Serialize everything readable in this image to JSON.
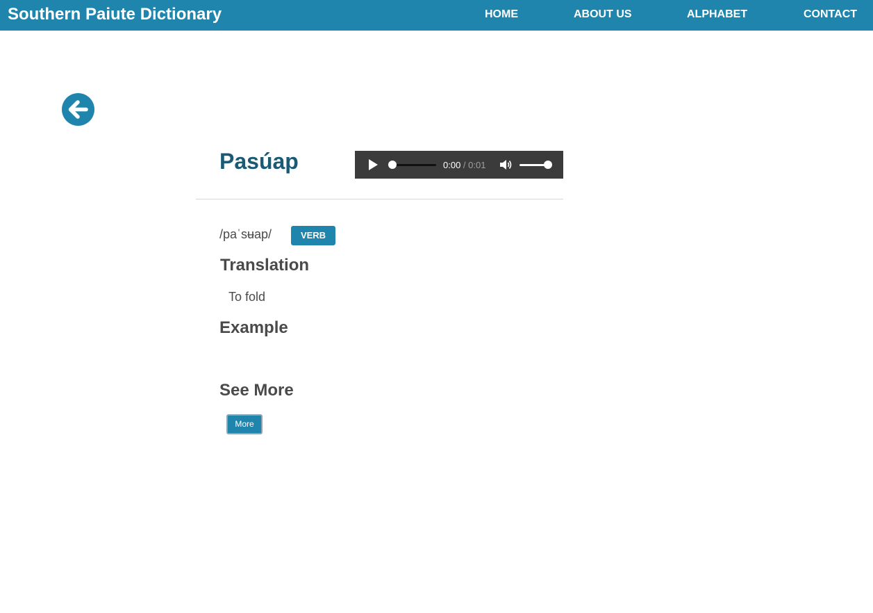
{
  "header": {
    "brand": "Southern Paiute Dictionary",
    "nav": [
      {
        "label": "HOME"
      },
      {
        "label": "ABOUT US"
      },
      {
        "label": "ALPHABET"
      },
      {
        "label": "CONTACT"
      }
    ],
    "color": "#2085ad"
  },
  "entry": {
    "word": "Pasúap",
    "phonetic": "/paˈsʉap/",
    "part_of_speech": "VERB",
    "translation_heading": "Translation",
    "translation": "To fold",
    "example_heading": "Example",
    "example": "",
    "see_more_heading": "See More",
    "more_button": "More"
  },
  "audio": {
    "current_time": "0:00",
    "separator": " / ",
    "duration": "0:01",
    "progress": 0,
    "volume": 1
  },
  "icons": {
    "back": "arrow-left-circle-icon",
    "play": "play-icon",
    "volume": "volume-icon"
  }
}
